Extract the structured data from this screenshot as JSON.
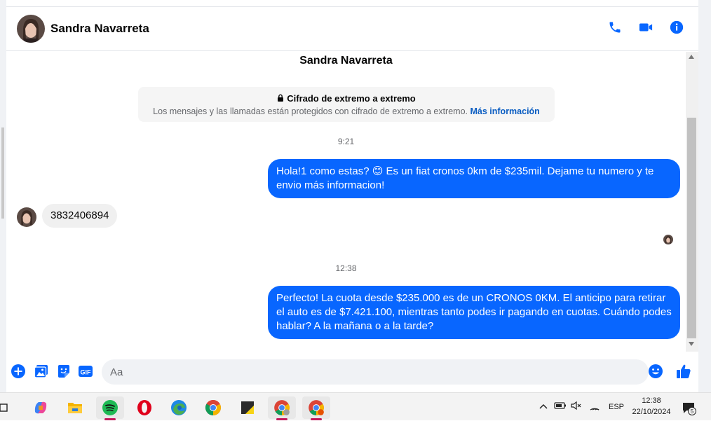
{
  "header": {
    "contact_name": "Sandra Navarreta",
    "actions": [
      "phone-icon",
      "video-icon",
      "info-icon"
    ]
  },
  "chat": {
    "title": "Sandra Navarreta",
    "e2e": {
      "title": "Cifrado de extremo a extremo",
      "description": "Los mensajes y las llamadas están protegidos con cifrado de extremo a extremo.",
      "link": "Más información"
    },
    "messages": [
      {
        "type": "time",
        "text": "9:21"
      },
      {
        "type": "outgoing",
        "text": "Hola!1 como estas? 😊 Es un fiat cronos 0km de $235mil. Dejame tu numero y te envio más informacion!"
      },
      {
        "type": "incoming",
        "text": "3832406894"
      },
      {
        "type": "time",
        "text": "12:38"
      },
      {
        "type": "outgoing",
        "text": "Perfecto! La cuota desde $235.000 es de un CRONOS 0KM. El anticipo para retirar el auto es de $7.421.100, mientras tanto podes ir pagando en cuotas. Cuándo podes hablar? A la mañana o a la tarde?"
      }
    ]
  },
  "composer": {
    "placeholder": "Aa",
    "gif_label": "GIF"
  },
  "taskbar": {
    "tray": {
      "language": "ESP",
      "time": "12:38",
      "date": "22/10/2024",
      "notification_count": "5"
    }
  },
  "colors": {
    "accent": "#0866ff",
    "incoming_bubble": "#f0f0f0",
    "link": "#0a5dc2"
  }
}
